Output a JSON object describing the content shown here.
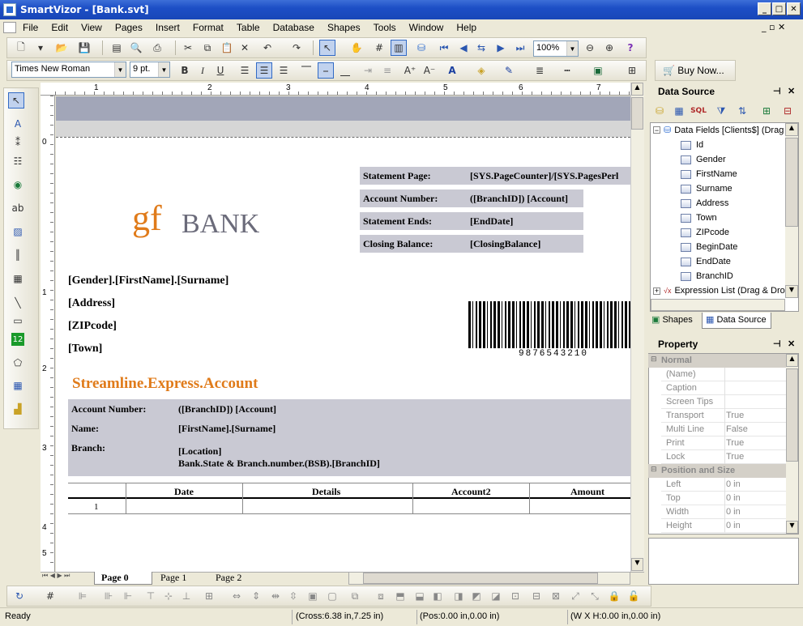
{
  "window": {
    "title": "SmartVizor - [Bank.svt]"
  },
  "menu": [
    "File",
    "Edit",
    "View",
    "Pages",
    "Insert",
    "Format",
    "Table",
    "Database",
    "Shapes",
    "Tools",
    "Window",
    "Help"
  ],
  "toolbar": {
    "zoom": "100%",
    "font": "Times New Roman",
    "size": "9 pt.",
    "buy_now": "Buy Now..."
  },
  "ruler": {
    "h_marks": [
      "1",
      "2",
      "3",
      "4",
      "5",
      "6",
      "7"
    ],
    "v_marks": [
      "0",
      "1",
      "2",
      "3",
      "4",
      "5"
    ]
  },
  "report": {
    "logo_gf": "gf",
    "logo_bank": "BANK",
    "statement": [
      {
        "label": "Statement Page:",
        "value": "[SYS.PageCounter]/[SYS.PagesPerl"
      },
      {
        "label": "Account Number:",
        "value": "([BranchID])  [Account]"
      },
      {
        "label": "Statement Ends:",
        "value": "[EndDate]"
      },
      {
        "label": "Closing Balance:",
        "value": "[ClosingBalance]"
      }
    ],
    "address": [
      "[Gender].[FirstName].[Surname]",
      "[Address]",
      "[ZIPcode]",
      "[Town]"
    ],
    "barcode_text": "9876543210",
    "section_title": "Streamline.Express.Account",
    "account_details": {
      "account_label": "Account Number:",
      "account_value": "([BranchID])  [Account]",
      "name_label": "Name:",
      "name_value": "[FirstName].[Surname]",
      "branch_label": "Branch:",
      "branch_value1": "[Location]",
      "branch_value2": "Bank.State & Branch.number.(BSB).[BranchID]"
    },
    "table": {
      "headers": [
        "Date",
        "Details",
        "Account2",
        "Amount"
      ],
      "row_num": "1"
    }
  },
  "page_tabs": [
    "Page   0",
    "Page   1",
    "Page   2"
  ],
  "data_source": {
    "title": "Data Source",
    "root": "Data Fields [Clients$] (Drag",
    "fields": [
      "Id",
      "Gender",
      "FirstName",
      "Surname",
      "Address",
      "Town",
      "ZIPcode",
      "BeginDate",
      "EndDate",
      "BranchID"
    ],
    "expr": "Expression List (Drag & Dro",
    "tabs": [
      "Shapes",
      "Data Source"
    ]
  },
  "property": {
    "title": "Property",
    "cat_normal": "Normal",
    "normal": [
      {
        "k": "(Name)",
        "v": ""
      },
      {
        "k": "Caption",
        "v": ""
      },
      {
        "k": "Screen Tips",
        "v": ""
      },
      {
        "k": "Transport",
        "v": "True"
      },
      {
        "k": "Multi Line",
        "v": "False"
      },
      {
        "k": "Print",
        "v": "True"
      },
      {
        "k": "Lock",
        "v": "True"
      }
    ],
    "cat_pos": "Position and Size",
    "pos": [
      {
        "k": "Left",
        "v": "0  in"
      },
      {
        "k": "Top",
        "v": "0  in"
      },
      {
        "k": "Width",
        "v": "0  in"
      },
      {
        "k": "Height",
        "v": "0  in"
      }
    ]
  },
  "status": {
    "ready": "Ready",
    "cross": "(Cross:6.38 in,7.25 in)",
    "pos": "(Pos:0.00 in,0.00 in)",
    "wh": "(W X H:0.00 in,0.00 in)"
  },
  "colors": {
    "accent_orange": "#e07b1a",
    "title_blue": "#1d4fc6",
    "gray_band": "#c9c9d3"
  }
}
